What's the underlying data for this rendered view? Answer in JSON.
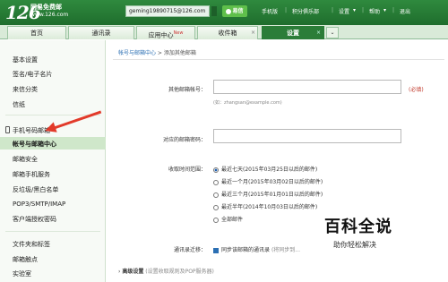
{
  "header": {
    "logo_num": "126",
    "logo_cn": "网易免费邮",
    "logo_url": "www.126.com",
    "account": "geming19890715@126.com",
    "yixin": "易信",
    "links": [
      "手机版",
      "积分俱乐部",
      "设置",
      "帮助",
      "退出"
    ]
  },
  "tabs": [
    {
      "label": "首页"
    },
    {
      "label": "通讯录"
    },
    {
      "label": "应用中心"
    },
    {
      "label": "收件箱"
    },
    {
      "label": "设置"
    }
  ],
  "tab_badge": "New",
  "sidebar": {
    "items": [
      "基本设置",
      "签名/电子名片",
      "来信分类",
      "信纸",
      "手机号码邮箱",
      "帐号与邮箱中心",
      "邮箱安全",
      "邮箱手机服务",
      "反垃圾/黑白名单",
      "POP3/SMTP/IMAP",
      "客户端授权密码",
      "文件夹和标签",
      "邮箱触点",
      "实验室"
    ]
  },
  "breadcrumb": {
    "parent": "帐号与邮箱中心",
    "sep": " > ",
    "current": "添加其他邮箱"
  },
  "form": {
    "other_account_label": "其他邮箱帐号：",
    "required": "(必填)",
    "example_hint": "(如：zhangsan@example.com)",
    "password_label": "对应的邮箱密码：",
    "range_label": "收取时间范围：",
    "options": [
      "最近七天(2015年03月25日以后的邮件)",
      "最近一个月(2015年03月02日以后的邮件)",
      "最近三个月(2015年01月01日以后的邮件)",
      "最近半年(2014年10月03日以后的邮件)",
      "全部邮件"
    ],
    "contacts_label": "通讯录迁移：",
    "sync_text": "同步该邮箱的通讯录",
    "sync_note": "(将同步到..."
  },
  "advanced": {
    "label": "高级设置",
    "note": "(设置收取规则及POP服务器)"
  },
  "watermark": {
    "title": "百科全说",
    "sub": "助你轻松解决"
  }
}
